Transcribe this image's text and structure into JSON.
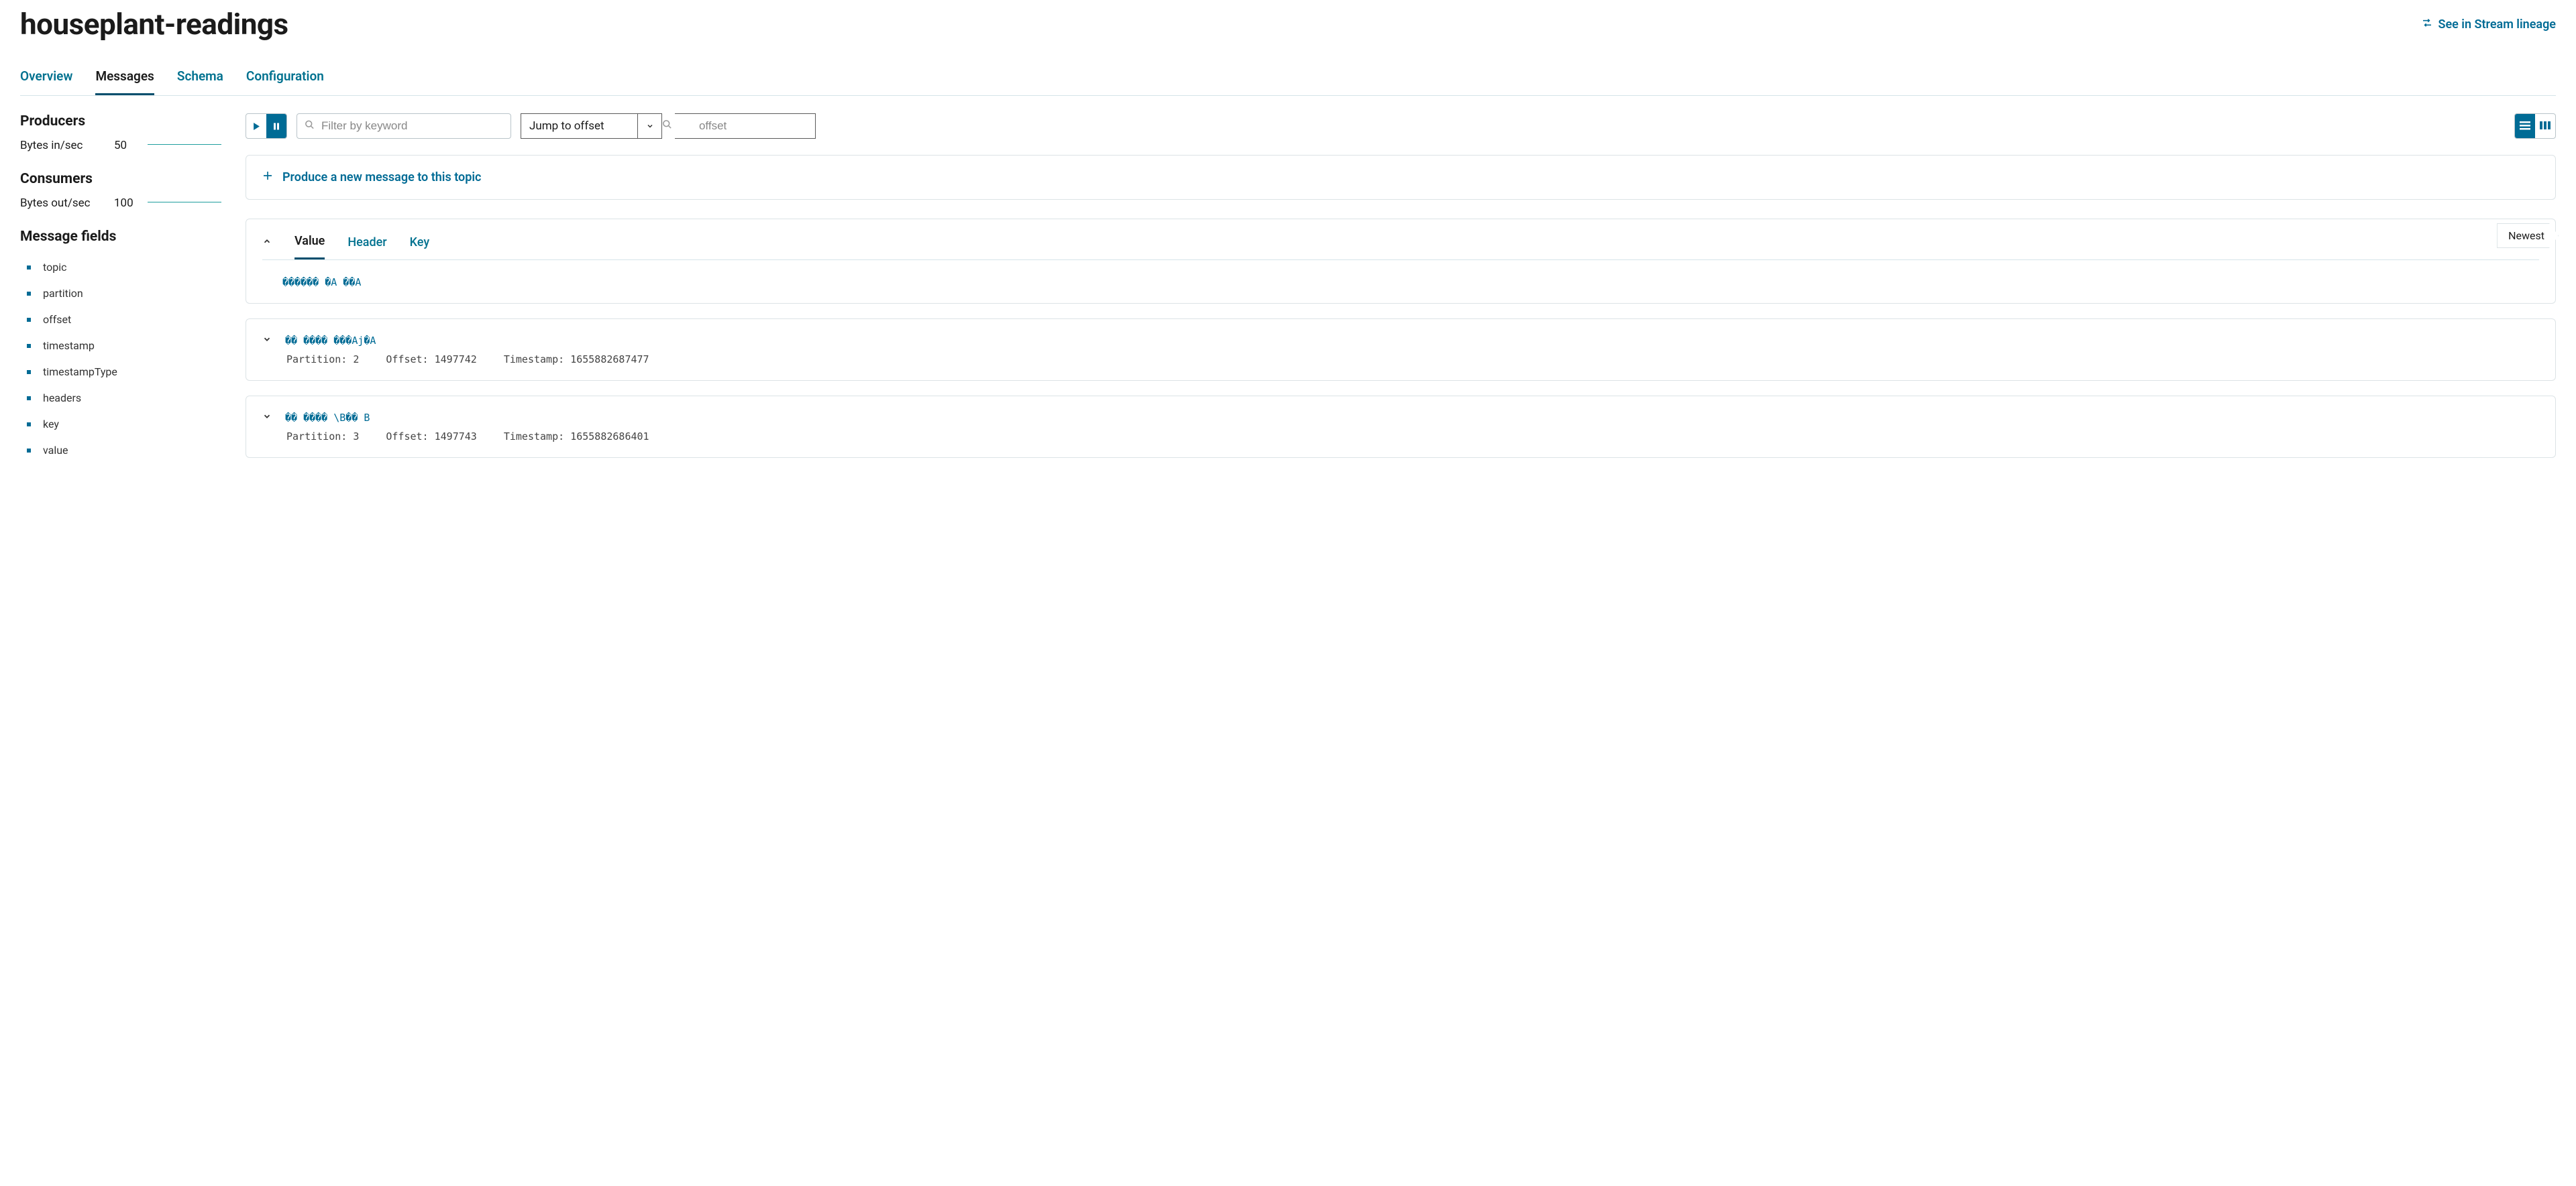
{
  "page": {
    "title": "houseplant-readings",
    "lineage_link": "See in Stream lineage"
  },
  "tabs": {
    "items": [
      {
        "label": "Overview",
        "active": false
      },
      {
        "label": "Messages",
        "active": true
      },
      {
        "label": "Schema",
        "active": false
      },
      {
        "label": "Configuration",
        "active": false
      }
    ]
  },
  "sidebar": {
    "producers": {
      "title": "Producers",
      "stat_label": "Bytes in/sec",
      "stat_value": "50"
    },
    "consumers": {
      "title": "Consumers",
      "stat_label": "Bytes out/sec",
      "stat_value": "100"
    },
    "fields": {
      "title": "Message fields",
      "items": [
        "topic",
        "partition",
        "offset",
        "timestamp",
        "timestampType",
        "headers",
        "key",
        "value"
      ]
    }
  },
  "toolbar": {
    "filter_placeholder": "Filter by keyword",
    "jump_label": "Jump to offset",
    "offset_placeholder": "offset"
  },
  "produce": {
    "label": "Produce a new message to this topic"
  },
  "message_card": {
    "subtabs": {
      "items": [
        {
          "label": "Value",
          "active": true
        },
        {
          "label": "Header",
          "active": false
        },
        {
          "label": "Key",
          "active": false
        }
      ]
    },
    "newest_label": "Newest",
    "value_text": "������ �A ��A"
  },
  "messages": [
    {
      "value": "�� ���� ���Aj�A",
      "partition_label": "Partition:",
      "partition": "2",
      "offset_label": "Offset:",
      "offset": "1497742",
      "timestamp_label": "Timestamp:",
      "timestamp": "1655882687477"
    },
    {
      "value": "�� ���� \\B�� B",
      "partition_label": "Partition:",
      "partition": "3",
      "offset_label": "Offset:",
      "offset": "1497743",
      "timestamp_label": "Timestamp:",
      "timestamp": "1655882686401"
    }
  ]
}
